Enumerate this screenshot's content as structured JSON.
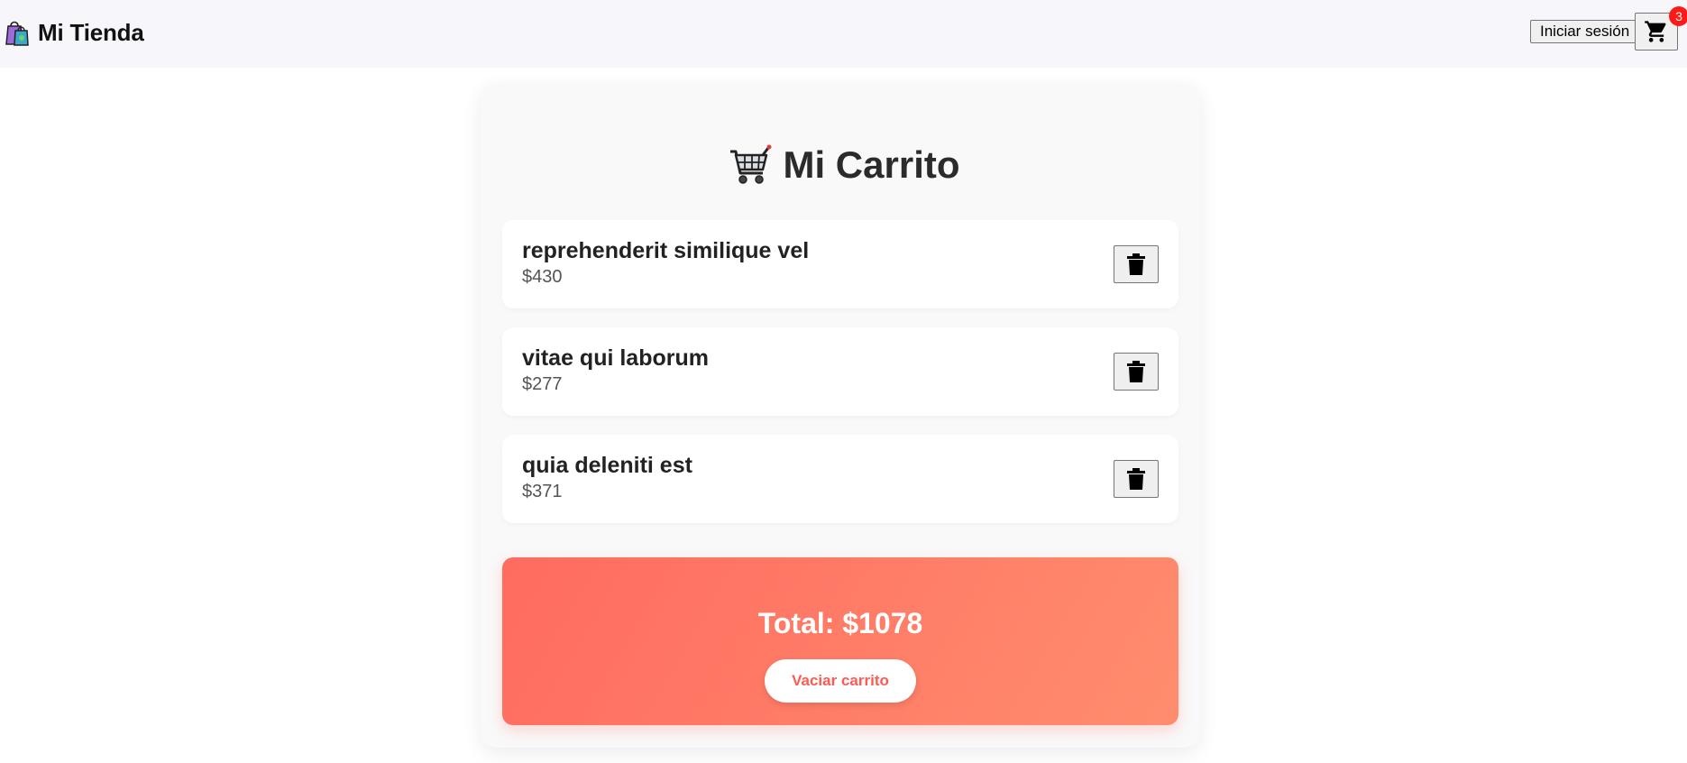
{
  "header": {
    "brand_icon": "shopping-bags-icon",
    "brand_title": "Mi Tienda",
    "login_label": "Iniciar sesión",
    "cart_icon": "cart-icon",
    "cart_count": "3"
  },
  "cart": {
    "heading_icon": "shopping-cart-icon",
    "heading": "Mi Carrito",
    "items": [
      {
        "name": "reprehenderit similique vel",
        "price": "$430",
        "delete_icon": "trash-icon"
      },
      {
        "name": "vitae qui laborum",
        "price": "$277",
        "delete_icon": "trash-icon"
      },
      {
        "name": "quia deleniti est",
        "price": "$371",
        "delete_icon": "trash-icon"
      }
    ],
    "total_label": "Total: $1078",
    "empty_label": "Vaciar carrito"
  },
  "colors": {
    "accent_gradient_start": "#ff6b5f",
    "accent_gradient_end": "#ff8d6e",
    "badge": "#ff1a1a",
    "empty_button_text": "#ff5a52"
  }
}
